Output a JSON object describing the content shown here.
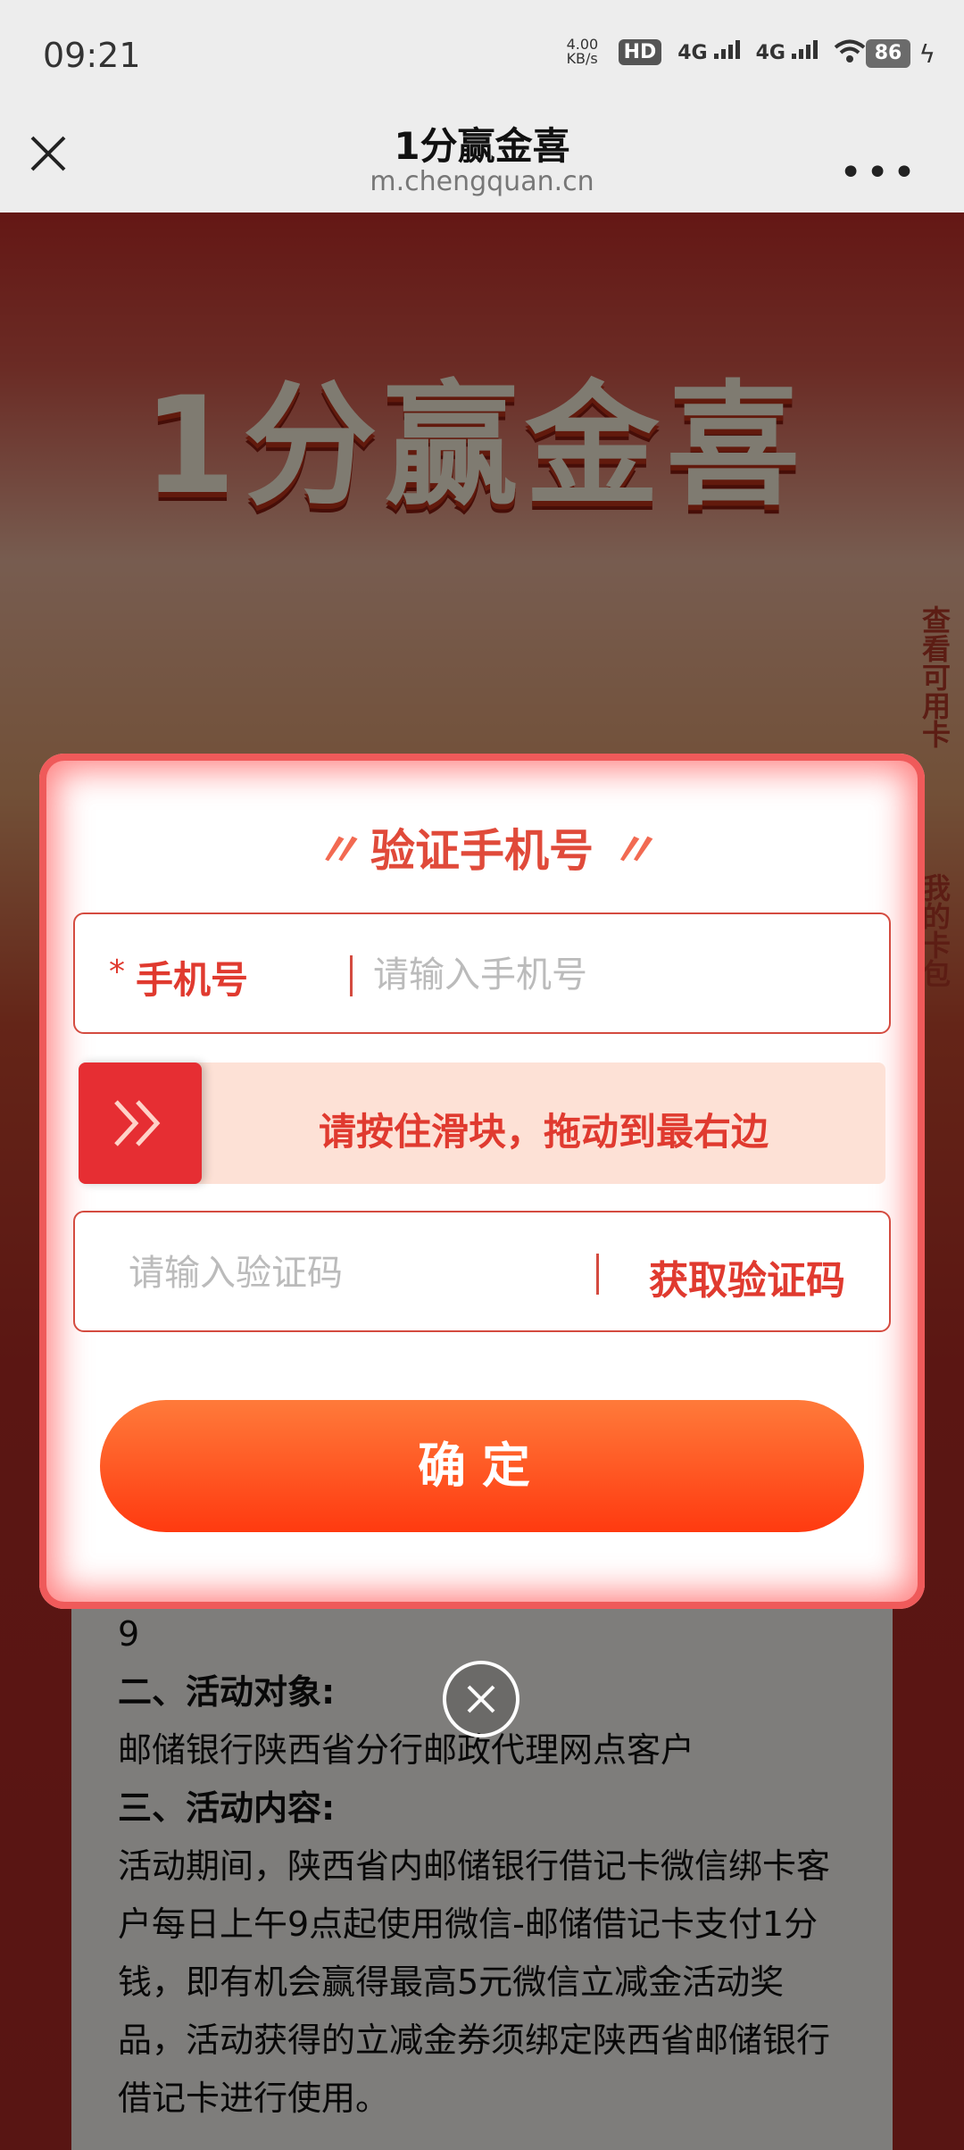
{
  "status_bar": {
    "time": "09:21",
    "speed": "4.00 KB/s",
    "hd_label": "HD",
    "network1": "4G",
    "network2": "4G",
    "battery": "86"
  },
  "nav": {
    "title": "1分赢金喜",
    "domain": "m.chengquan.cn"
  },
  "background": {
    "banner_title": "1分赢金喜",
    "side_tab_cards": "查看可用卡",
    "side_tab_mycards": "我的卡包",
    "rules": {
      "partial_line": "9",
      "section2_title": "二、活动对象:",
      "section2_text": "邮储银行陕西省分行邮政代理网点客户",
      "section3_title": "三、活动内容:",
      "section3_text": "活动期间，陕西省内邮储银行借记卡微信绑卡客户每日上午9点起使用微信-邮储借记卡支付1分钱，即有机会赢得最高5元微信立减金活动奖品，活动获得的立减金券须绑定陕西省邮储银行借记卡进行使用。"
    }
  },
  "dialog": {
    "title": "验证手机号",
    "title_quote": "〃",
    "phone": {
      "required_mark": "*",
      "label": "手机号",
      "placeholder": "请输入手机号",
      "value": ""
    },
    "slider": {
      "hint": "请按住滑块，拖动到最右边",
      "progress": 0
    },
    "code": {
      "placeholder": "请输入验证码",
      "value": "",
      "get_code_label": "获取验证码"
    },
    "confirm_label": "确定"
  },
  "colors": {
    "accent_red": "#e03a2f",
    "button_orange": "#ff5a20",
    "slider_bg": "#fde1d6"
  }
}
